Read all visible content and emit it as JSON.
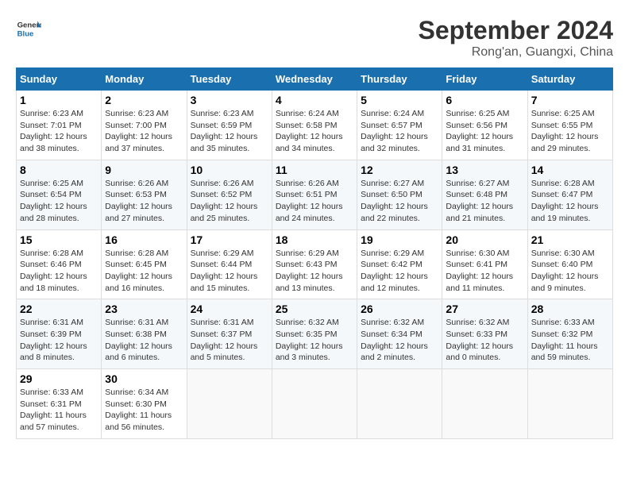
{
  "header": {
    "logo_general": "General",
    "logo_blue": "Blue",
    "month": "September 2024",
    "location": "Rong'an, Guangxi, China"
  },
  "days_of_week": [
    "Sunday",
    "Monday",
    "Tuesday",
    "Wednesday",
    "Thursday",
    "Friday",
    "Saturday"
  ],
  "weeks": [
    [
      {
        "day": "1",
        "sunrise": "6:23 AM",
        "sunset": "7:01 PM",
        "daylight": "12 hours and 38 minutes."
      },
      {
        "day": "2",
        "sunrise": "6:23 AM",
        "sunset": "7:00 PM",
        "daylight": "12 hours and 37 minutes."
      },
      {
        "day": "3",
        "sunrise": "6:23 AM",
        "sunset": "6:59 PM",
        "daylight": "12 hours and 35 minutes."
      },
      {
        "day": "4",
        "sunrise": "6:24 AM",
        "sunset": "6:58 PM",
        "daylight": "12 hours and 34 minutes."
      },
      {
        "day": "5",
        "sunrise": "6:24 AM",
        "sunset": "6:57 PM",
        "daylight": "12 hours and 32 minutes."
      },
      {
        "day": "6",
        "sunrise": "6:25 AM",
        "sunset": "6:56 PM",
        "daylight": "12 hours and 31 minutes."
      },
      {
        "day": "7",
        "sunrise": "6:25 AM",
        "sunset": "6:55 PM",
        "daylight": "12 hours and 29 minutes."
      }
    ],
    [
      {
        "day": "8",
        "sunrise": "6:25 AM",
        "sunset": "6:54 PM",
        "daylight": "12 hours and 28 minutes."
      },
      {
        "day": "9",
        "sunrise": "6:26 AM",
        "sunset": "6:53 PM",
        "daylight": "12 hours and 27 minutes."
      },
      {
        "day": "10",
        "sunrise": "6:26 AM",
        "sunset": "6:52 PM",
        "daylight": "12 hours and 25 minutes."
      },
      {
        "day": "11",
        "sunrise": "6:26 AM",
        "sunset": "6:51 PM",
        "daylight": "12 hours and 24 minutes."
      },
      {
        "day": "12",
        "sunrise": "6:27 AM",
        "sunset": "6:50 PM",
        "daylight": "12 hours and 22 minutes."
      },
      {
        "day": "13",
        "sunrise": "6:27 AM",
        "sunset": "6:48 PM",
        "daylight": "12 hours and 21 minutes."
      },
      {
        "day": "14",
        "sunrise": "6:28 AM",
        "sunset": "6:47 PM",
        "daylight": "12 hours and 19 minutes."
      }
    ],
    [
      {
        "day": "15",
        "sunrise": "6:28 AM",
        "sunset": "6:46 PM",
        "daylight": "12 hours and 18 minutes."
      },
      {
        "day": "16",
        "sunrise": "6:28 AM",
        "sunset": "6:45 PM",
        "daylight": "12 hours and 16 minutes."
      },
      {
        "day": "17",
        "sunrise": "6:29 AM",
        "sunset": "6:44 PM",
        "daylight": "12 hours and 15 minutes."
      },
      {
        "day": "18",
        "sunrise": "6:29 AM",
        "sunset": "6:43 PM",
        "daylight": "12 hours and 13 minutes."
      },
      {
        "day": "19",
        "sunrise": "6:29 AM",
        "sunset": "6:42 PM",
        "daylight": "12 hours and 12 minutes."
      },
      {
        "day": "20",
        "sunrise": "6:30 AM",
        "sunset": "6:41 PM",
        "daylight": "12 hours and 11 minutes."
      },
      {
        "day": "21",
        "sunrise": "6:30 AM",
        "sunset": "6:40 PM",
        "daylight": "12 hours and 9 minutes."
      }
    ],
    [
      {
        "day": "22",
        "sunrise": "6:31 AM",
        "sunset": "6:39 PM",
        "daylight": "12 hours and 8 minutes."
      },
      {
        "day": "23",
        "sunrise": "6:31 AM",
        "sunset": "6:38 PM",
        "daylight": "12 hours and 6 minutes."
      },
      {
        "day": "24",
        "sunrise": "6:31 AM",
        "sunset": "6:37 PM",
        "daylight": "12 hours and 5 minutes."
      },
      {
        "day": "25",
        "sunrise": "6:32 AM",
        "sunset": "6:35 PM",
        "daylight": "12 hours and 3 minutes."
      },
      {
        "day": "26",
        "sunrise": "6:32 AM",
        "sunset": "6:34 PM",
        "daylight": "12 hours and 2 minutes."
      },
      {
        "day": "27",
        "sunrise": "6:32 AM",
        "sunset": "6:33 PM",
        "daylight": "12 hours and 0 minutes."
      },
      {
        "day": "28",
        "sunrise": "6:33 AM",
        "sunset": "6:32 PM",
        "daylight": "11 hours and 59 minutes."
      }
    ],
    [
      {
        "day": "29",
        "sunrise": "6:33 AM",
        "sunset": "6:31 PM",
        "daylight": "11 hours and 57 minutes."
      },
      {
        "day": "30",
        "sunrise": "6:34 AM",
        "sunset": "6:30 PM",
        "daylight": "11 hours and 56 minutes."
      },
      null,
      null,
      null,
      null,
      null
    ]
  ],
  "labels": {
    "sunrise": "Sunrise: ",
    "sunset": "Sunset: ",
    "daylight": "Daylight: "
  }
}
